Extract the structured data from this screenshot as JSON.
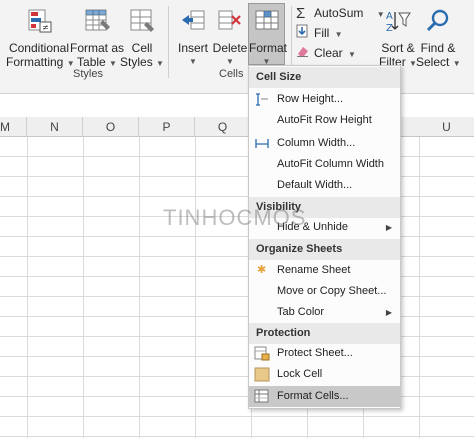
{
  "ribbon": {
    "styles_group": {
      "label": "Styles",
      "conditional_formatting": "Conditional",
      "conditional_formatting_line2": "Formatting",
      "format_as_table": "Format as",
      "format_as_table_line2": "Table",
      "cell_styles": "Cell",
      "cell_styles_line2": "Styles"
    },
    "cells_group": {
      "label": "Cells",
      "insert": "Insert",
      "delete": "Delete",
      "format": "Format"
    },
    "editing_group": {
      "autosum": "AutoSum",
      "fill": "Fill",
      "clear": "Clear",
      "sort_filter": "Sort &",
      "sort_filter_line2": "Filter",
      "find_select": "Find &",
      "find_select_line2": "Select"
    }
  },
  "columns": [
    "M",
    "N",
    "O",
    "P",
    "Q",
    "U"
  ],
  "format_menu": {
    "cell_size": {
      "header": "Cell Size",
      "items": [
        "Row Height...",
        "AutoFit Row Height",
        "Column Width...",
        "AutoFit Column Width",
        "Default Width..."
      ]
    },
    "visibility": {
      "header": "Visibility",
      "items": [
        "Hide & Unhide"
      ]
    },
    "organize_sheets": {
      "header": "Organize Sheets",
      "items": [
        "Rename Sheet",
        "Move or Copy Sheet...",
        "Tab Color"
      ]
    },
    "protection": {
      "header": "Protection",
      "items": [
        "Protect Sheet...",
        "Lock Cell",
        "Format Cells..."
      ]
    }
  },
  "watermark": "TINHOCMOS",
  "colors": {
    "ribbon_bg": "#f3f3f3",
    "format_button_active": "#c5c5c5",
    "menu_section_bg": "#e9e9e9",
    "menu_highlight": "#c8c8c8",
    "icon_blue": "#2b6cb0",
    "icon_green": "#2e9c48",
    "icon_red": "#d13438"
  },
  "icons": [
    "conditional-formatting-icon",
    "format-as-table-icon",
    "cell-styles-icon",
    "insert-icon",
    "delete-icon",
    "format-icon",
    "autosum-icon",
    "fill-icon",
    "clear-icon",
    "sort-filter-icon",
    "find-select-icon",
    "row-height-icon",
    "column-width-icon",
    "rename-sheet-bullet-icon",
    "protect-sheet-icon",
    "lock-cell-icon",
    "format-cells-icon"
  ]
}
